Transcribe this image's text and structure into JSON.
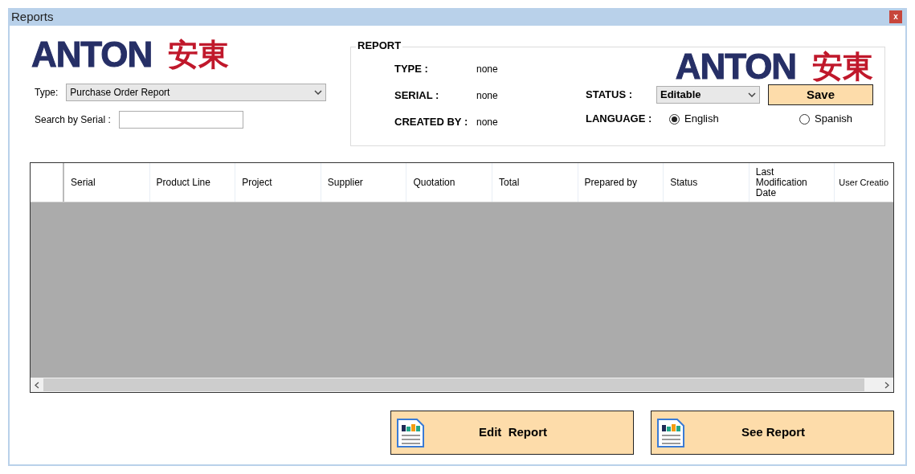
{
  "window": {
    "title": "Reports",
    "close": "x"
  },
  "logo": {
    "latin": "ANTON",
    "cjk": "安東"
  },
  "filters": {
    "type_label": "Type:",
    "type_value": "Purchase Order Report",
    "search_label": "Search by Serial :"
  },
  "report": {
    "title": "REPORT",
    "logo": {
      "latin": "ANTON",
      "cjk": "安東"
    },
    "fields": [
      {
        "label": "TYPE :",
        "value": "none"
      },
      {
        "label": "SERIAL :",
        "value": "none"
      },
      {
        "label": "CREATED BY :",
        "value": "none"
      }
    ],
    "status": {
      "label": "STATUS :",
      "value": "Editable"
    },
    "save": "Save",
    "language": {
      "label": "LANGUAGE :",
      "options": [
        {
          "label": "English",
          "selected": true
        },
        {
          "label": "Spanish",
          "selected": false
        }
      ]
    }
  },
  "table": {
    "columns": [
      "Serial",
      "Product Line",
      "Project",
      "Supplier",
      "Quotation",
      "Total",
      "Prepared by",
      "Status",
      "Last Modification Date",
      "User Creatio"
    ]
  },
  "buttons": [
    "Edit  Report",
    "See Report"
  ]
}
